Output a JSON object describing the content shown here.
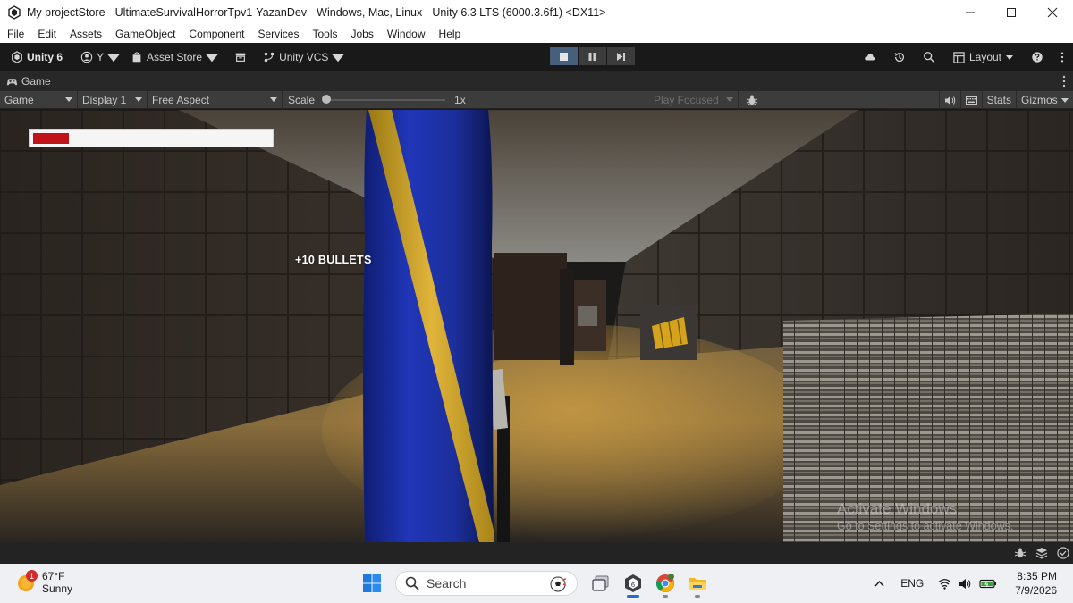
{
  "window": {
    "title": "My projectStore - UltimateSurvivalHorrorTpv1-YazanDev - Windows, Mac, Linux - Unity 6.3 LTS (6000.3.6f1) <DX11>"
  },
  "menu": [
    "File",
    "Edit",
    "Assets",
    "GameObject",
    "Component",
    "Services",
    "Tools",
    "Jobs",
    "Window",
    "Help"
  ],
  "toolbar": {
    "unity_label": "Unity 6",
    "account_label": "Y",
    "asset_store_label": "Asset Store",
    "vcs_label": "Unity VCS",
    "layout_label": "Layout"
  },
  "game_tab": {
    "label": "Game"
  },
  "game_bar": {
    "view_label": "Game",
    "display_label": "Display 1",
    "aspect_label": "Free Aspect",
    "scale_label": "Scale",
    "scale_value": "1x",
    "play_focused_label": "Play Focused",
    "stats_label": "Stats",
    "gizmos_label": "Gizmos"
  },
  "hud": {
    "health_fraction": 0.15,
    "pickup_message": "+10 BULLETS"
  },
  "watermark": {
    "line1": "Activate Windows",
    "line2": "Go to Settings to activate Windows."
  },
  "taskbar": {
    "weather_temp": "67°F",
    "weather_condition": "Sunny",
    "weather_badge": "1",
    "search_placeholder": "Search",
    "language": "ENG",
    "time": "8:35 PM",
    "date": "7/9/2026"
  },
  "colors": {
    "play_active": "#46607c",
    "health_fill": "#c0141a",
    "taskbar_bg": "#eef0f4"
  }
}
